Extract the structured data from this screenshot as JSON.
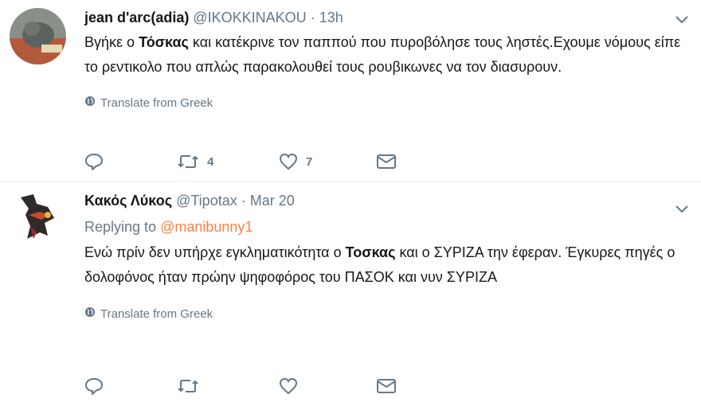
{
  "tweets": [
    {
      "name": "jean d'arc(adia)",
      "handle": "@IKOKKINAKOU",
      "separator": "·",
      "time": "13h",
      "text_before": "Βγήκε ο ",
      "text_bold": "Τόσκας",
      "text_after": " και κατέκρινε τον παππού που πυροβόλησε τους ληστές.Εχουμε νόμους είπε το ρεντικολο που απλώς παρακολουθεί τους ρουβικωνες να τον διασυρουν.",
      "translate": "Translate from Greek",
      "retweets": "4",
      "likes": "7"
    },
    {
      "name": "Κακός Λύκος",
      "handle": "@Tipotax",
      "separator": "·",
      "time": "Mar 20",
      "replying_label": "Replying to",
      "replying_to": "@manibunny1",
      "text_before": "Ενώ πρίν δεν υπήρχε εγκληματικότητα ο ",
      "text_bold": "Τοσκας",
      "text_after": " και ο ΣΥΡΙΖΑ την έφεραν. Έγκυρες πηγές ο δολοφόνος ήταν πρώην ψηφοφόρος του ΠΑΣΟΚ και νυν ΣΥΡΙΖΑ",
      "translate": "Translate from Greek"
    }
  ],
  "colors": {
    "text": "#14171a",
    "secondary": "#657786",
    "mention": "#ff7f3f",
    "divider": "#e6ecf0"
  },
  "icons": [
    "chevron-down-icon",
    "globe-icon",
    "reply-icon",
    "retweet-icon",
    "heart-icon",
    "dm-envelope-icon"
  ]
}
